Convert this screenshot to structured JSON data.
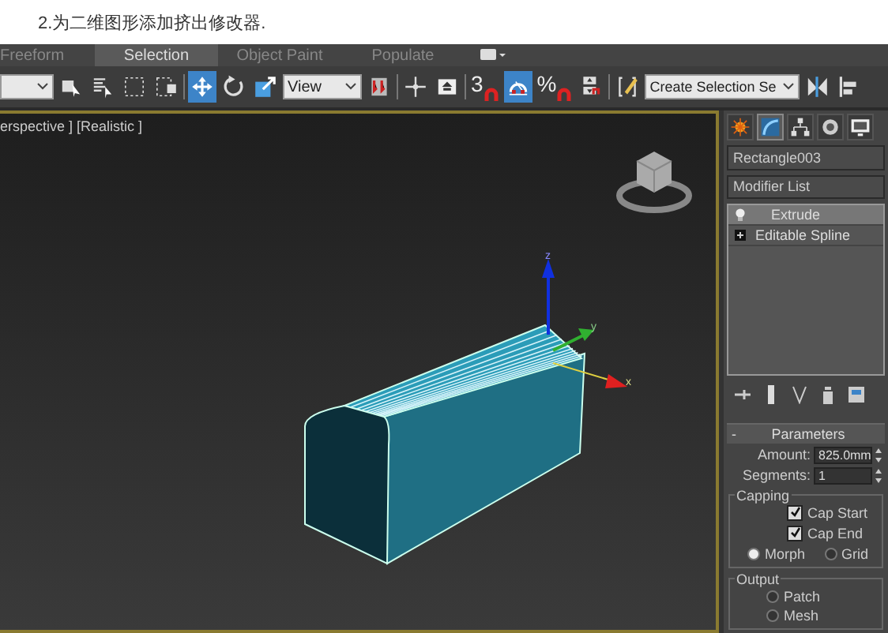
{
  "caption": "2.为二维图形添加挤出修改器.",
  "ribbon_tabs": [
    {
      "label": "Freeform",
      "selected": false
    },
    {
      "label": "Selection",
      "selected": true
    },
    {
      "label": "Object Paint",
      "selected": false
    },
    {
      "label": "Populate",
      "selected": false
    }
  ],
  "toolbar": [
    {
      "kind": "dropdown"
    },
    {
      "kind": "tool",
      "selected": false
    },
    {
      "kind": "tool",
      "selected": false
    },
    {
      "kind": "tool",
      "selected": false
    },
    {
      "kind": "tool",
      "selected": false
    },
    {
      "kind": "separator"
    },
    {
      "kind": "tool",
      "selected": true
    },
    {
      "kind": "tool",
      "selected": false
    },
    {
      "kind": "tool",
      "selected": false
    },
    {
      "kind": "dropdown",
      "value": "View"
    },
    {
      "kind": "tool",
      "selected": false
    },
    {
      "kind": "separator"
    },
    {
      "kind": "tool",
      "selected": false
    },
    {
      "kind": "tool",
      "selected": false
    },
    {
      "kind": "separator"
    },
    {
      "kind": "snap",
      "glyph": "3",
      "selected": false
    },
    {
      "kind": "tool",
      "selected": true
    },
    {
      "kind": "snap",
      "glyph": "%",
      "selected": false
    },
    {
      "kind": "tool",
      "selected": false
    },
    {
      "kind": "separator"
    },
    {
      "kind": "tool",
      "selected": false
    },
    {
      "kind": "dropdown",
      "value": "Create Selection Se"
    },
    {
      "kind": "tool",
      "selected": false
    },
    {
      "kind": "tool",
      "selected": false
    }
  ],
  "viewport": {
    "label": "erspective ] [Realistic ]",
    "gizmo_labels": [
      "z",
      "y",
      "x"
    ]
  },
  "command_panel": {
    "tabs": [
      {
        "selected": false
      },
      {
        "selected": true
      },
      {
        "selected": false
      },
      {
        "selected": false
      },
      {
        "selected": false
      }
    ],
    "object_name": "Rectangle003",
    "modifier_list": "Modifier List",
    "stack": [
      {
        "kind": "modifier",
        "label": "Extrude",
        "selected": true
      },
      {
        "kind": "base",
        "label": "Editable Spline",
        "selected": false
      }
    ],
    "parameters": {
      "collapse": "-",
      "title": "Parameters",
      "amount_label": "Amount:",
      "amount": "825.0mm",
      "segments_label": "Segments:",
      "segments": "1",
      "capping": {
        "title": "Capping",
        "checks": [
          {
            "label": "Cap Start",
            "checked": true
          },
          {
            "label": "Cap End",
            "checked": true
          }
        ],
        "radios": [
          {
            "label": "Morph",
            "selected": true
          },
          {
            "label": "Grid",
            "selected": false
          }
        ]
      },
      "output": {
        "title": "Output",
        "radios": [
          {
            "label": "Patch",
            "selected": false
          },
          {
            "label": "Mesh",
            "selected": false
          }
        ]
      }
    }
  }
}
